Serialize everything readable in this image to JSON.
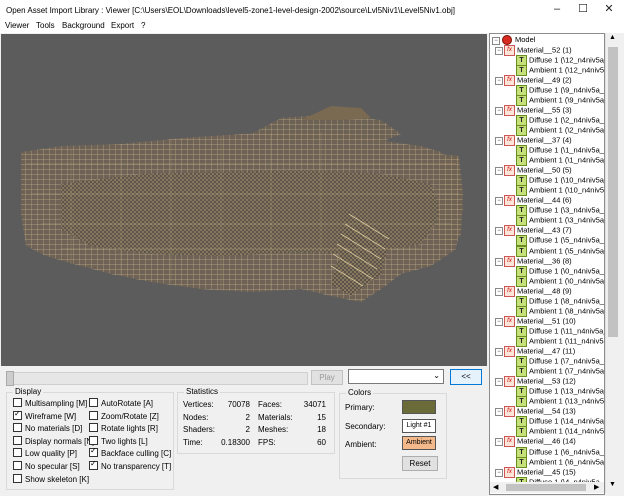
{
  "window": {
    "title": "Open Asset Import Library : Viewer  [C:\\Users\\EOL\\Downloads\\level5-zone1-level-design-2002\\source\\Lvl5Niv1\\Level5Niv1.obj]"
  },
  "menu": [
    "Viewer",
    "Tools",
    "Background",
    "Export",
    "?"
  ],
  "animation": {
    "play_label": "Play",
    "collapse_label": "<<"
  },
  "display": {
    "title": "Display",
    "options": [
      {
        "label": "Multisampling [M]",
        "checked": false
      },
      {
        "label": "AutoRotate [A]",
        "checked": false
      },
      {
        "label": "Wireframe [W]",
        "checked": true
      },
      {
        "label": "Zoom/Rotate [Z]",
        "checked": false
      },
      {
        "label": "No materials [D]",
        "checked": false
      },
      {
        "label": "Rotate lights [R]",
        "checked": false
      },
      {
        "label": "Display normals [N]",
        "checked": false
      },
      {
        "label": "Two lights [L]",
        "checked": false
      },
      {
        "label": "Low quality [P]",
        "checked": false
      },
      {
        "label": "Backface culling [C]",
        "checked": true
      },
      {
        "label": "No specular [S]",
        "checked": false
      },
      {
        "label": "No transparency [T]",
        "checked": true
      },
      {
        "label": "Show skeleton [K]",
        "checked": false
      }
    ]
  },
  "statistics": {
    "title": "Statistics",
    "rows": [
      {
        "label": "Vertices:",
        "value": "70078",
        "label2": "Faces:",
        "value2": "34071"
      },
      {
        "label": "Nodes:",
        "value": "2",
        "label2": "Materials:",
        "value2": "15"
      },
      {
        "label": "Shaders:",
        "value": "2",
        "label2": "Meshes:",
        "value2": "18"
      },
      {
        "label": "Time:",
        "value": "0.18300",
        "label2": "FPS:",
        "value2": "60"
      }
    ]
  },
  "colors": {
    "title": "Colors",
    "primary_label": "Primary:",
    "secondary_label": "Secondary:",
    "secondary_value": "Light #1",
    "ambient_label": "Ambient:",
    "ambient_value": "Ambient",
    "reset_label": "Reset",
    "primary_color": "#6b6b3a",
    "ambient_color": "#f4b98b"
  },
  "tree": {
    "root": "Model",
    "materials": [
      {
        "name": "Material__52 (1)",
        "diffuse": "Diffuse 1 (\\12_n4niv5a_test",
        "ambient": "Ambient 1 (\\12_n4niv5a_test"
      },
      {
        "name": "Material__49 (2)",
        "diffuse": "Diffuse 1 (\\9_n4niv5a_grds",
        "ambient": "Ambient 1 (\\9_n4niv5a_grds"
      },
      {
        "name": "Material__55 (3)",
        "diffuse": "Diffuse 1 (\\2_n4niv5a_sol_",
        "ambient": "Ambient 1 (\\2_n4niv5a_sol_"
      },
      {
        "name": "Material__37 (4)",
        "diffuse": "Diffuse 1 (\\1_n4niv5a_mur_",
        "ambient": "Ambient 1 (\\1_n4niv5a_mur_"
      },
      {
        "name": "Material__50 (5)",
        "diffuse": "Diffuse 1 (\\10_n4niv5a_ele",
        "ambient": "Ambient 1 (\\10_n4niv5a_ele"
      },
      {
        "name": "Material__44 (6)",
        "diffuse": "Diffuse 1 (\\3_n4niv5a_bure",
        "ambient": "Ambient 1 (\\3_n4niv5a_bure"
      },
      {
        "name": "Material__43 (7)",
        "diffuse": "Diffuse 1 (\\5_n4niv5a_moq",
        "ambient": "Ambient 1 (\\5_n4niv5a_moq"
      },
      {
        "name": "Material__36 (8)",
        "diffuse": "Diffuse 1 (\\0_n4niv5a_sol.p",
        "ambient": "Ambient 1 (\\0_n4niv5a_sol.p"
      },
      {
        "name": "Material__48 (9)",
        "diffuse": "Diffuse 1 (\\8_n4niv5a_usine",
        "ambient": "Ambient 1 (\\8_n4niv5a_usin"
      },
      {
        "name": "Material__51 (10)",
        "diffuse": "Diffuse 1 (\\11_n4niv5a_ma",
        "ambient": "Ambient 1 (\\11_n4niv5a_ma"
      },
      {
        "name": "Material__47 (11)",
        "diffuse": "Diffuse 1 (\\7_n4niv5a_mach",
        "ambient": "Ambient 1 (\\7_n4niv5a_mac"
      },
      {
        "name": "Material__53 (12)",
        "diffuse": "Diffuse 1 (\\13_n4niv5a_tes",
        "ambient": "Ambient 1 (\\13_n4niv5a_tes"
      },
      {
        "name": "Material__54 (13)",
        "diffuse": "Diffuse 1 (\\14_n4niv5a_cou",
        "ambient": "Ambient 1 (\\14_n4niv5a_cou"
      },
      {
        "name": "Material__46 (14)",
        "diffuse": "Diffuse 1 (\\6_n4niv5a_mur",
        "ambient": "Ambient 1 (\\6_n4niv5a_mur"
      },
      {
        "name": "Material__45 (15)",
        "diffuse": "Diffuse 1 (\\4_n4niv5a_sol_",
        "ambient": ""
      }
    ]
  }
}
